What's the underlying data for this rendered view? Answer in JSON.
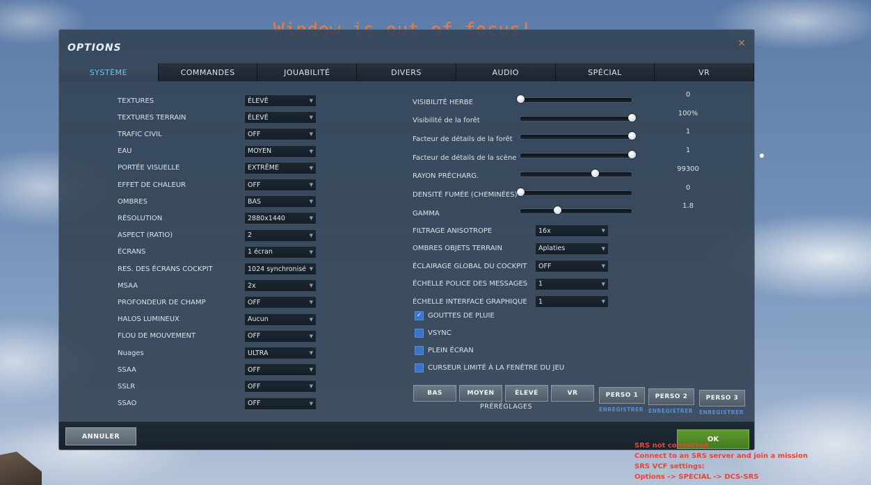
{
  "overlay": {
    "focus_message": "Window is out of focus!"
  },
  "window": {
    "title": "OPTIONS",
    "close_symbol": "×"
  },
  "tabs": [
    {
      "label": "SYSTÈME",
      "active": true
    },
    {
      "label": "COMMANDES"
    },
    {
      "label": "JOUABILITÉ"
    },
    {
      "label": "DIVERS"
    },
    {
      "label": "AUDIO"
    },
    {
      "label": "SPÉCIAL"
    },
    {
      "label": "VR"
    }
  ],
  "left_settings": [
    {
      "label": "TEXTURES",
      "value": "ÉLEVÉ"
    },
    {
      "label": "TEXTURES TERRAIN",
      "value": "ÉLEVÉ"
    },
    {
      "label": "TRAFIC CIVIL",
      "value": "OFF"
    },
    {
      "label": "EAU",
      "value": "MOYEN"
    },
    {
      "label": "PORTÉE VISUELLE",
      "value": "EXTRÊME"
    },
    {
      "label": "EFFET DE CHALEUR",
      "value": "OFF"
    },
    {
      "label": "OMBRES",
      "value": "BAS"
    },
    {
      "label": "RÉSOLUTION",
      "value": "2880x1440"
    },
    {
      "label": "ASPECT (RATIO)",
      "value": "2"
    },
    {
      "label": "ÉCRANS",
      "value": "1 écran"
    },
    {
      "label": "RES. DES ÉCRANS COCKPIT",
      "value": "1024 synchronisé"
    },
    {
      "label": "MSAA",
      "value": "2x"
    },
    {
      "label": "PROFONDEUR DE CHAMP",
      "value": "OFF"
    },
    {
      "label": "HALOS LUMINEUX",
      "value": "Aucun"
    },
    {
      "label": "FLOU DE MOUVEMENT",
      "value": "OFF"
    },
    {
      "label": "Nuages",
      "value": "ULTRA"
    },
    {
      "label": "SSAA",
      "value": "OFF"
    },
    {
      "label": "SSLR",
      "value": "OFF"
    },
    {
      "label": "SSAO",
      "value": "OFF"
    }
  ],
  "sliders": [
    {
      "label": "VISIBILITÉ HERBE",
      "value": "0",
      "fraction": 0.0
    },
    {
      "label": "Visibilité de la forêt",
      "value": "100%",
      "fraction": 1.0
    },
    {
      "label": "Facteur de détails de la forêt",
      "value": "1",
      "fraction": 1.0
    },
    {
      "label": "Facteur de détails de la scène",
      "value": "1",
      "fraction": 1.0
    },
    {
      "label": "RAYON PRÉCHARG.",
      "value": "99300",
      "fraction": 0.67
    },
    {
      "label": "DENSITÉ FUMÉE (CHEMINÉES)",
      "value": "0",
      "fraction": 0.0
    },
    {
      "label": "GAMMA",
      "value": "1.8",
      "fraction": 0.33
    }
  ],
  "right_settings": [
    {
      "label": "FILTRAGE ANISOTROPE",
      "value": "16x"
    },
    {
      "label": "OMBRES OBJETS TERRAIN",
      "value": "Aplaties"
    },
    {
      "label": "ÉCLAIRAGE GLOBAL DU COCKPIT",
      "value": "OFF"
    },
    {
      "label": "ÉCHELLE POLICE DES MESSAGES",
      "value": "1"
    },
    {
      "label": "ÉCHELLE INTERFACE GRAPHIQUE",
      "value": "1"
    }
  ],
  "checkboxes": [
    {
      "label": "GOUTTES DE PLUIE",
      "checked": true,
      "mark": "✓"
    },
    {
      "label": "VSYNC",
      "checked": false,
      "mark": ""
    },
    {
      "label": "PLEIN ÉCRAN",
      "checked": false,
      "mark": ""
    },
    {
      "label": "CURSEUR LIMITÉ À LA FENÊTRE DU JEU",
      "checked": false,
      "mark": ""
    }
  ],
  "presets": {
    "caption": "PRÉRÉGLAGES",
    "buttons": [
      "BAS",
      "MOYEN",
      "ÉLEVÉ",
      "VR"
    ],
    "custom": [
      {
        "label": "PERSO 1",
        "save": "ENREGISTRER"
      },
      {
        "label": "PERSO 2",
        "save": "ENREGISTRER"
      },
      {
        "label": "PERSO 3",
        "save": "ENREGISTRER"
      }
    ]
  },
  "footer": {
    "cancel": "ANNULER",
    "ok": "OK"
  },
  "srs_status": [
    "SRS not connected",
    "Connect to an SRS server and join a mission",
    "SRS VCF settings:",
    "Options -> SPECIAL -> DCS-SRS"
  ],
  "colors": {
    "accent": "#6fc6ef",
    "ok_green": "#5d9a30",
    "focus_warning": "#f07a3c",
    "srs_red": "#e8453a",
    "checkbox_blue": "#3b74c4"
  }
}
